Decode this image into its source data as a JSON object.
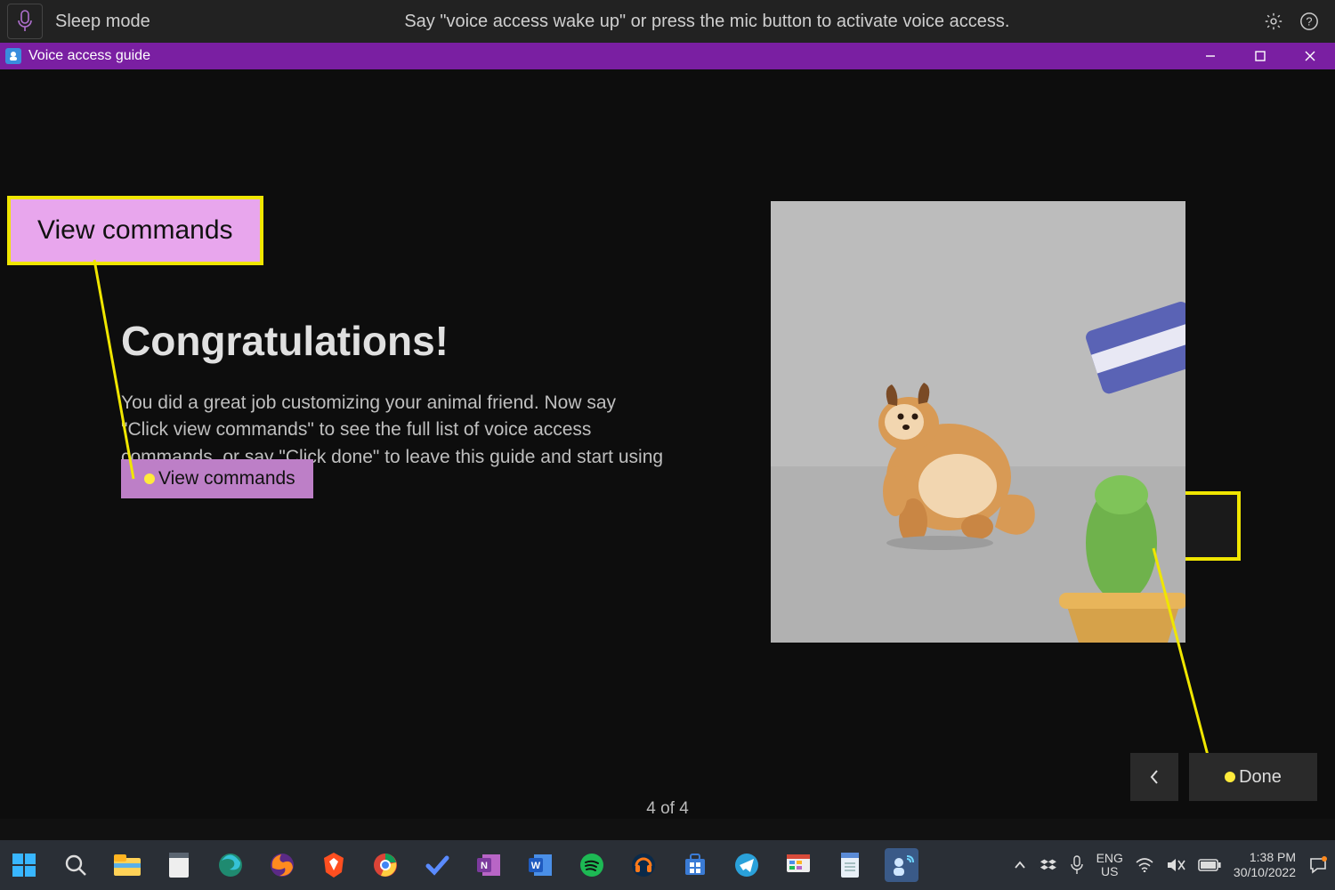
{
  "voice_access_bar": {
    "mode": "Sleep mode",
    "prompt": "Say \"voice access wake up\" or press the mic button to activate voice access."
  },
  "title_bar": {
    "title": "Voice access guide"
  },
  "guide": {
    "heading": "Congratulations!",
    "body": "You did a great job customizing your animal friend. Now say \"Click view commands\" to see the full list of voice access commands, or say \"Click done\" to leave this guide and start using voice access.",
    "view_commands_label": "View commands",
    "pager": "4 of 4",
    "done_label": "Done"
  },
  "callouts": {
    "view_commands": "View commands",
    "done": "Done"
  },
  "system_tray": {
    "lang_line1": "ENG",
    "lang_line2": "US",
    "time": "1:38 PM",
    "date": "30/10/2022"
  }
}
